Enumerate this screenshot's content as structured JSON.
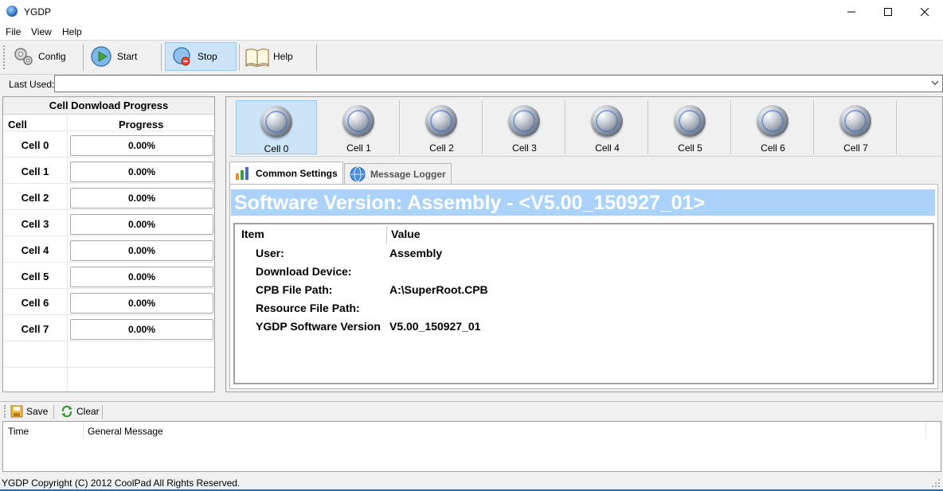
{
  "window": {
    "title": "YGDP"
  },
  "menu": [
    "File",
    "View",
    "Help"
  ],
  "toolbar": {
    "config_label": "Config",
    "start_label": "Start",
    "stop_label": "Stop",
    "help_label": "Help"
  },
  "last_used": {
    "label": "Last Used:",
    "value": ""
  },
  "left_panel": {
    "title": "Cell Donwload Progress",
    "col_cell": "Cell",
    "col_progress": "Progress",
    "rows": [
      {
        "cell": "Cell 0",
        "progress": "0.00%"
      },
      {
        "cell": "Cell 1",
        "progress": "0.00%"
      },
      {
        "cell": "Cell 2",
        "progress": "0.00%"
      },
      {
        "cell": "Cell 3",
        "progress": "0.00%"
      },
      {
        "cell": "Cell 4",
        "progress": "0.00%"
      },
      {
        "cell": "Cell 5",
        "progress": "0.00%"
      },
      {
        "cell": "Cell 6",
        "progress": "0.00%"
      },
      {
        "cell": "Cell 7",
        "progress": "0.00%"
      }
    ]
  },
  "cells": [
    "Cell 0",
    "Cell 1",
    "Cell 2",
    "Cell 3",
    "Cell 4",
    "Cell 5",
    "Cell 6",
    "Cell 7"
  ],
  "tabs": {
    "common": "Common Settings",
    "logger": "Message Logger"
  },
  "settings": {
    "version_banner": "Software Version:  Assembly - <V5.00_150927_01>",
    "col_item": "Item",
    "col_value": "Value",
    "rows": [
      {
        "item": "User:",
        "value": "Assembly"
      },
      {
        "item": "Download Device:",
        "value": ""
      },
      {
        "item": "CPB File Path:",
        "value": "A:\\SuperRoot.CPB"
      },
      {
        "item": "Resource File Path:",
        "value": ""
      },
      {
        "item": "YGDP Software Version",
        "value": "V5.00_150927_01"
      }
    ]
  },
  "log": {
    "save_label": "Save",
    "clear_label": "Clear",
    "col_time": "Time",
    "col_message": "General Message"
  },
  "status": {
    "text": "YGDP Copyright (C) 2012 CoolPad All Rights Reserved."
  },
  "colors": {
    "accent": "#0078d7",
    "banner": "#aad2fa",
    "selected": "#cce4f7"
  }
}
